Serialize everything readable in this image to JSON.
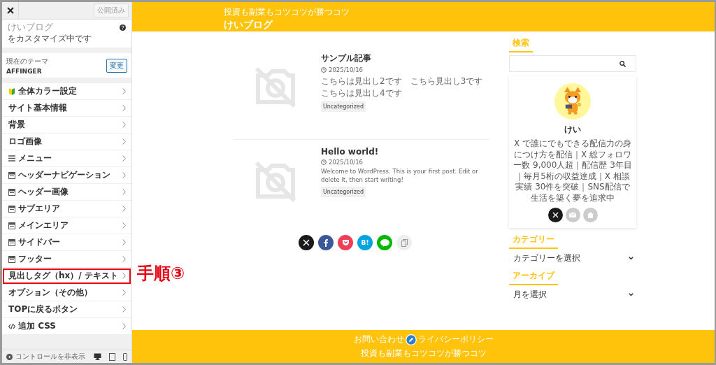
{
  "customizer": {
    "publish_button": "公開済み",
    "site_title": "けいブログ",
    "subtitle": "をカスタマイズ中です",
    "theme_label": "現在のテーマ",
    "theme_name": "AFFINGER",
    "change_button": "変更",
    "items": [
      {
        "label": "全体カラー設定",
        "kind": "leaf",
        "annotated": false
      },
      {
        "label": "サイト基本情報",
        "kind": "none",
        "annotated": false
      },
      {
        "label": "背景",
        "kind": "none",
        "annotated": false
      },
      {
        "label": "ロゴ画像",
        "kind": "none",
        "annotated": false
      },
      {
        "label": "メニュー",
        "kind": "menu",
        "annotated": false
      },
      {
        "label": "ヘッダーナビゲーション",
        "kind": "layout",
        "annotated": false
      },
      {
        "label": "ヘッダー画像",
        "kind": "layout",
        "annotated": false
      },
      {
        "label": "サブエリア",
        "kind": "layout",
        "annotated": false
      },
      {
        "label": "メインエリア",
        "kind": "layout",
        "annotated": false
      },
      {
        "label": "サイドバー",
        "kind": "layout",
        "annotated": false
      },
      {
        "label": "フッター",
        "kind": "layout",
        "annotated": false
      },
      {
        "label": "見出しタグ（hx）/ テキスト",
        "kind": "none",
        "annotated": true
      },
      {
        "label": "オプション（その他）",
        "kind": "none",
        "annotated": false
      },
      {
        "label": "TOPに戻るボタン",
        "kind": "none",
        "annotated": false
      },
      {
        "label": "追加 CSS",
        "kind": "code",
        "annotated": false
      }
    ],
    "hide_controls": "コントロールを非表示"
  },
  "annotation": {
    "text": "手順③"
  },
  "preview": {
    "tagline": "投資も副業もコツコツが勝つコツ",
    "blog_title": "けいブログ",
    "posts": [
      {
        "title": "サンプル記事",
        "date": "2025/10/16",
        "excerpt": [
          "こちらは見出し2です",
          "こちら見出し3です",
          "こちらは見出し4です"
        ],
        "category": "Uncategorized"
      },
      {
        "title": "Hello world!",
        "date": "2025/10/16",
        "excerpt": "Welcome to WordPress. This is your first post. Edit or delete it, then start writing!",
        "category": "Uncategorized"
      }
    ],
    "share_buttons": [
      {
        "kind": "x",
        "color": "#1a1a1a"
      },
      {
        "kind": "facebook",
        "color": "#3b5998"
      },
      {
        "kind": "pocket",
        "color": "#ef3f56"
      },
      {
        "kind": "hatena",
        "color": "#00a4de",
        "label": "B!"
      },
      {
        "kind": "line",
        "color": "#00b900"
      },
      {
        "kind": "copy",
        "color": "#eeeeee"
      }
    ],
    "sidebar": {
      "search_heading": "検索",
      "profile_name": "けい",
      "profile_text": "X で誰にでもできる配信力の身につけ方を配信｜X 総フォロワー数 9,000人超｜配信歴 3年目｜毎月5桁の収益達成｜X 相談実績 30件を突破｜SNS配信で生活を築く夢を追求中",
      "profile_links": [
        {
          "kind": "x",
          "color": "#1a1a1a"
        },
        {
          "kind": "mail",
          "color": "#cccccc"
        },
        {
          "kind": "home",
          "color": "#cccccc"
        }
      ],
      "category_heading": "カテゴリー",
      "category_select": "カテゴリーを選択",
      "archive_heading": "アーカイブ",
      "archive_select": "月を選択"
    },
    "footer": {
      "links": [
        "お問い合わせ",
        "ライバシーポリシー"
      ],
      "tagline": "投資も副業もコツコツが勝つコツ"
    }
  }
}
